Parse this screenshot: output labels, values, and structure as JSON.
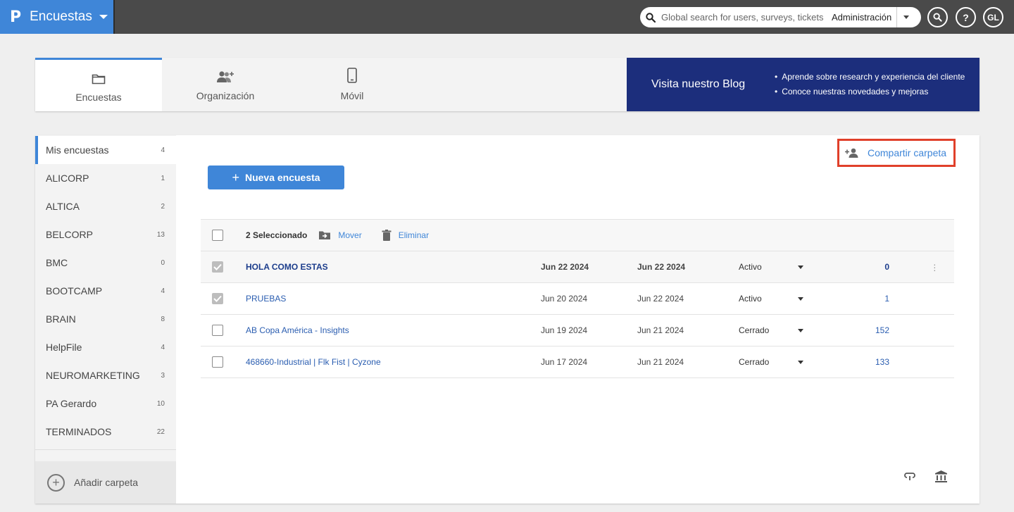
{
  "header": {
    "logo": "P",
    "app_name": "Encuestas",
    "search_placeholder": "Global search for users, surveys, tickets",
    "search_scope": "Administración",
    "help_label": "?",
    "avatar_initials": "GL"
  },
  "tabs": [
    {
      "label": "Encuestas",
      "icon": "folder-icon",
      "active": true
    },
    {
      "label": "Organización",
      "icon": "add-user-group-icon",
      "active": false
    },
    {
      "label": "Móvil",
      "icon": "mobile-phone-icon",
      "active": false
    }
  ],
  "blog": {
    "title": "Visita nuestro Blog",
    "bullets": [
      "Aprende sobre research y experiencia del cliente",
      "Conoce nuestras novedades y mejoras"
    ]
  },
  "sidebar": {
    "folders": [
      {
        "name": "Mis encuestas",
        "count": "4",
        "active": true
      },
      {
        "name": "ALICORP",
        "count": "1"
      },
      {
        "name": "ALTICA",
        "count": "2"
      },
      {
        "name": "BELCORP",
        "count": "13"
      },
      {
        "name": "BMC",
        "count": "0"
      },
      {
        "name": "BOOTCAMP",
        "count": "4"
      },
      {
        "name": "BRAIN",
        "count": "8"
      },
      {
        "name": "HelpFile",
        "count": "4"
      },
      {
        "name": "NEUROMARKETING",
        "count": "3"
      },
      {
        "name": "PA Gerardo",
        "count": "10"
      },
      {
        "name": "TERMINADOS",
        "count": "22"
      }
    ],
    "add_folder_label": "Añadir carpeta"
  },
  "main": {
    "share_label": "Compartir carpeta",
    "new_survey_label": "Nueva encuesta",
    "selection_text": "2 Seleccionado",
    "move_label": "Mover",
    "delete_label": "Eliminar"
  },
  "surveys": [
    {
      "name": "HOLA COMO ESTAS",
      "created": "Jun 22 2024",
      "modified": "Jun 22 2024",
      "status": "Activo",
      "responses": "0",
      "checked": true,
      "highlighted": true
    },
    {
      "name": "PRUEBAS",
      "created": "Jun 20 2024",
      "modified": "Jun 22 2024",
      "status": "Activo",
      "responses": "1",
      "checked": true,
      "highlighted": false
    },
    {
      "name": "AB Copa América - Insights",
      "created": "Jun 19 2024",
      "modified": "Jun 21 2024",
      "status": "Cerrado",
      "responses": "152",
      "checked": false,
      "highlighted": false
    },
    {
      "name": "468660-Industrial | Flk Fist | Cyzone",
      "created": "Jun 17 2024",
      "modified": "Jun 21 2024",
      "status": "Cerrado",
      "responses": "133",
      "checked": false,
      "highlighted": false
    }
  ],
  "colors": {
    "brand_blue": "#3f86d8",
    "topbar": "#4a4a4a",
    "blog_navy": "#1c2e7c",
    "highlight_red": "#e0402a"
  }
}
